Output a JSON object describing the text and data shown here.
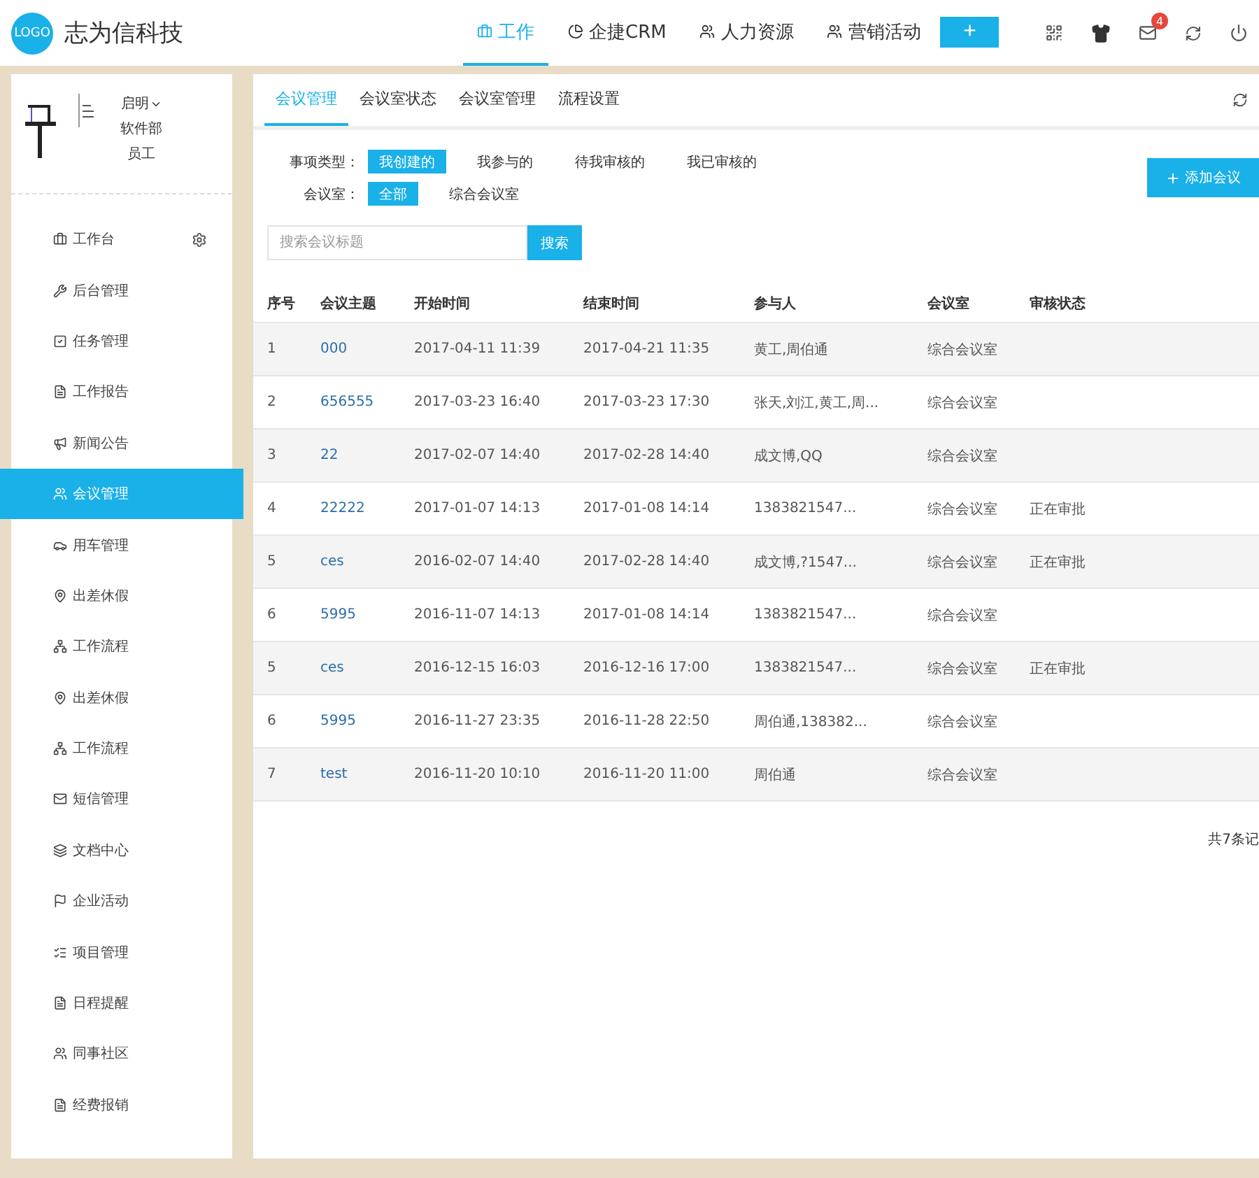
{
  "header": {
    "logo_badge": "LOGO",
    "brand": "志为信科技",
    "nav": [
      {
        "label": "工作",
        "kind": "briefcase",
        "selected": true
      },
      {
        "label": "企捷CRM",
        "kind": "pie",
        "selected": false
      },
      {
        "label": "人力资源",
        "kind": "users",
        "selected": false
      },
      {
        "label": "营销活动",
        "kind": "users",
        "selected": false
      }
    ],
    "add_button": "+",
    "mail_badge": "4"
  },
  "user": {
    "name": "启明",
    "department": "软件部",
    "role": "员工"
  },
  "sidebar": {
    "items": [
      {
        "label": "工作台",
        "kind": "briefcase",
        "selected": false,
        "settings": true
      },
      {
        "label": "后台管理",
        "kind": "tools",
        "selected": false,
        "settings": false
      },
      {
        "label": "任务管理",
        "kind": "check",
        "selected": false,
        "settings": false
      },
      {
        "label": "工作报告",
        "kind": "report",
        "selected": false,
        "settings": false
      },
      {
        "label": "新闻公告",
        "kind": "megaphone",
        "selected": false,
        "settings": false
      },
      {
        "label": "会议管理",
        "kind": "meeting",
        "selected": true,
        "settings": false
      },
      {
        "label": "用车管理",
        "kind": "car",
        "selected": false,
        "settings": false
      },
      {
        "label": "出差休假",
        "kind": "pin",
        "selected": false,
        "settings": false
      },
      {
        "label": "工作流程",
        "kind": "flow",
        "selected": false,
        "settings": false
      },
      {
        "label": "出差休假",
        "kind": "pin",
        "selected": false,
        "settings": false
      },
      {
        "label": "工作流程",
        "kind": "flow",
        "selected": false,
        "settings": false
      },
      {
        "label": "短信管理",
        "kind": "mail",
        "selected": false,
        "settings": false
      },
      {
        "label": "文档中心",
        "kind": "layers",
        "selected": false,
        "settings": false
      },
      {
        "label": "企业活动",
        "kind": "flag",
        "selected": false,
        "settings": false
      },
      {
        "label": "项目管理",
        "kind": "list",
        "selected": false,
        "settings": false
      },
      {
        "label": "日程提醒",
        "kind": "report",
        "selected": false,
        "settings": false
      },
      {
        "label": "同事社区",
        "kind": "users",
        "selected": false,
        "settings": false
      },
      {
        "label": "经费报销",
        "kind": "report",
        "selected": false,
        "settings": false
      }
    ]
  },
  "tabs": [
    {
      "label": "会议管理",
      "selected": true
    },
    {
      "label": "会议室状态",
      "selected": false
    },
    {
      "label": "会议室管理",
      "selected": false
    },
    {
      "label": "流程设置",
      "selected": false
    }
  ],
  "filters": [
    {
      "label": "事项类型：",
      "options": [
        {
          "label": "我创建的",
          "selected": true
        },
        {
          "label": "我参与的",
          "selected": false
        },
        {
          "label": "待我审核的",
          "selected": false
        },
        {
          "label": "我已审核的",
          "selected": false
        }
      ]
    },
    {
      "label": "会议室：",
      "options": [
        {
          "label": "全部",
          "selected": true
        },
        {
          "label": "综合会议室",
          "selected": false
        }
      ]
    }
  ],
  "add_meeting_button": "添加会议",
  "search": {
    "placeholder": "搜索会议标题",
    "button": "搜索"
  },
  "table": {
    "columns": [
      "序号",
      "会议主题",
      "开始时间",
      "结束时间",
      "参与人",
      "会议室",
      "审核状态"
    ],
    "rows": [
      [
        "1",
        "000",
        "2017-04-11 11:39",
        "2017-04-21 11:35",
        "黄工,周伯通",
        "综合会议室",
        ""
      ],
      [
        "2",
        "656555",
        "2017-03-23 16:40",
        "2017-03-23 17:30",
        "张天,刘江,黄工,周...",
        "综合会议室",
        ""
      ],
      [
        "3",
        "22",
        "2017-02-07 14:40",
        "2017-02-28 14:40",
        "成文博,QQ",
        "综合会议室",
        ""
      ],
      [
        "4",
        "22222",
        "2017-01-07 14:13",
        "2017-01-08 14:14",
        "1383821547...",
        "综合会议室",
        "正在审批"
      ],
      [
        "5",
        "ces",
        "2016-02-07 14:40",
        "2017-02-28 14:40",
        "成文博,?1547...",
        "综合会议室",
        "正在审批"
      ],
      [
        "6",
        "5995",
        "2016-11-07 14:13",
        "2017-01-08 14:14",
        "1383821547...",
        "综合会议室",
        ""
      ],
      [
        "5",
        "ces",
        "2016-12-15 16:03",
        "2016-12-16 17:00",
        "1383821547...",
        "综合会议室",
        "正在审批"
      ],
      [
        "6",
        "5995",
        "2016-11-27 23:35",
        "2016-11-28 22:50",
        "周伯通,138382...",
        "综合会议室",
        ""
      ],
      [
        "7",
        "test",
        "2016-11-20 10:10",
        "2016-11-20 11:00",
        "周伯通",
        "综合会议室",
        ""
      ]
    ]
  },
  "pagination": "共7条记"
}
